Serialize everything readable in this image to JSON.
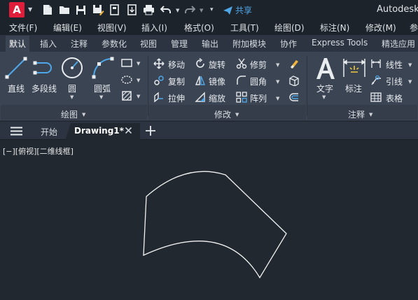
{
  "titlebar": {
    "logo_letter": "A",
    "share_label": "共享",
    "app_title": "Autodesk"
  },
  "menu": [
    "文件(F)",
    "编辑(E)",
    "视图(V)",
    "插入(I)",
    "格式(O)",
    "工具(T)",
    "绘图(D)",
    "标注(N)",
    "修改(M)",
    "参"
  ],
  "ribbon_tabs": [
    "默认",
    "插入",
    "注释",
    "参数化",
    "视图",
    "管理",
    "输出",
    "附加模块",
    "协作",
    "Express Tools",
    "精选应用"
  ],
  "ribbon": {
    "draw": {
      "title": "绘图",
      "line": "直线",
      "polyline": "多段线",
      "circle": "圆",
      "arc": "圆弧"
    },
    "modify": {
      "title": "修改",
      "move": "移动",
      "rotate": "旋转",
      "trim": "修剪",
      "copy": "复制",
      "mirror": "镜像",
      "fillet": "圆角",
      "stretch": "拉伸",
      "scale": "缩放",
      "array": "阵列"
    },
    "annotation": {
      "title": "注释",
      "text": "文字",
      "dimension": "标注",
      "linear": "线性",
      "leader": "引线",
      "table": "表格"
    }
  },
  "doc_tabs": {
    "start": "开始",
    "active": "Drawing1*"
  },
  "viewport_label": "[−][俯视][二维线框]",
  "colors": {
    "accent_red": "#e01e39",
    "share_blue": "#4fa7e8",
    "ribbon_bg": "#3b4453",
    "canvas_bg": "#212830"
  }
}
